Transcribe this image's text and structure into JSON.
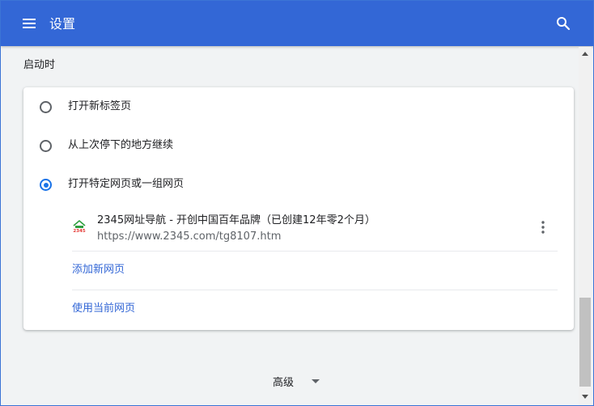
{
  "toolbar": {
    "title": "设置",
    "menu_icon": "menu-icon",
    "search_icon": "search-icon",
    "background_color": "#3367d6"
  },
  "startup": {
    "section_title": "启动时",
    "options": [
      {
        "label": "打开新标签页",
        "checked": false
      },
      {
        "label": "从上次停下的地方继续",
        "checked": false
      },
      {
        "label": "打开特定网页或一组网页",
        "checked": true
      }
    ],
    "pages": [
      {
        "title": "2345网址导航 - 开创中国百年品牌（已创建12年零2个月）",
        "url": "https://www.2345.com/tg8107.htm",
        "favicon_text": "2345",
        "menu_icon": "more-vert-icon"
      }
    ],
    "add_page_label": "添加新网页",
    "use_current_label": "使用当前网页"
  },
  "advanced": {
    "label": "高级",
    "icon": "arrow-drop-down-icon"
  },
  "colors": {
    "accent": "#1a73e8",
    "link": "#3367d6"
  }
}
